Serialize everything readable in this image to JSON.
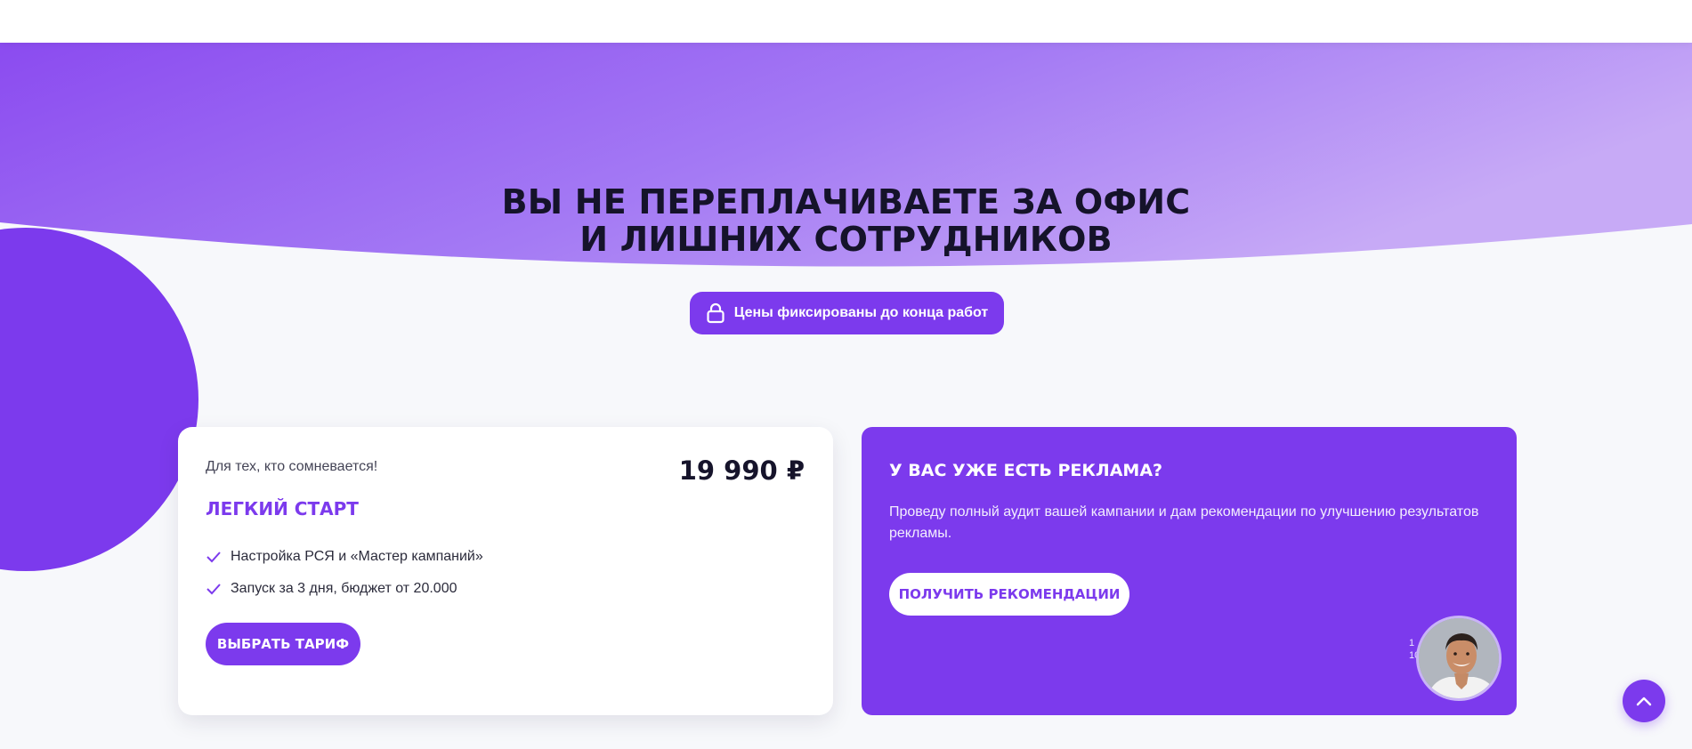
{
  "hero": {
    "title_line1": "ВЫ НЕ ПЕРЕПЛАЧИВАЕТЕ ЗА ОФИС",
    "title_line2": "И ЛИШНИХ СОТРУДНИКОВ",
    "badge_label": "Цены фиксированы до конца работ",
    "badge_icon": "lock-icon"
  },
  "plan_card": {
    "subtitle": "Для тех, кто сомневается!",
    "price": "19 990 ₽",
    "plan_name": "ЛЕГКИЙ СТАРТ",
    "features": [
      "Настройка РСЯ и «Мастер кампаний»",
      "Запуск за 3 дня, бюджет от 20.000"
    ],
    "feature_icon": "check-icon",
    "button_label": "ВЫБРАТЬ ТАРИФ"
  },
  "audit_card": {
    "heading": "У ВАС УЖЕ ЕСТЬ РЕКЛАМА?",
    "text": "Проведу полный аудит вашей кампании и дам рекомендации по улучшению результатов рекламы.",
    "button_label": "ПОЛУЧИТЬ РЕКОМЕНДАЦИИ",
    "fragment_line1": "1",
    "fragment_line2": "10"
  },
  "widgets": {
    "avatar_icon": "consultant-avatar",
    "scroll_top_icon": "chevron-up-icon"
  },
  "colors": {
    "accent": "#7c3aed",
    "accent_light": "#c9b3f7",
    "text_dark": "#15132a",
    "background": "#f7f8fb"
  }
}
